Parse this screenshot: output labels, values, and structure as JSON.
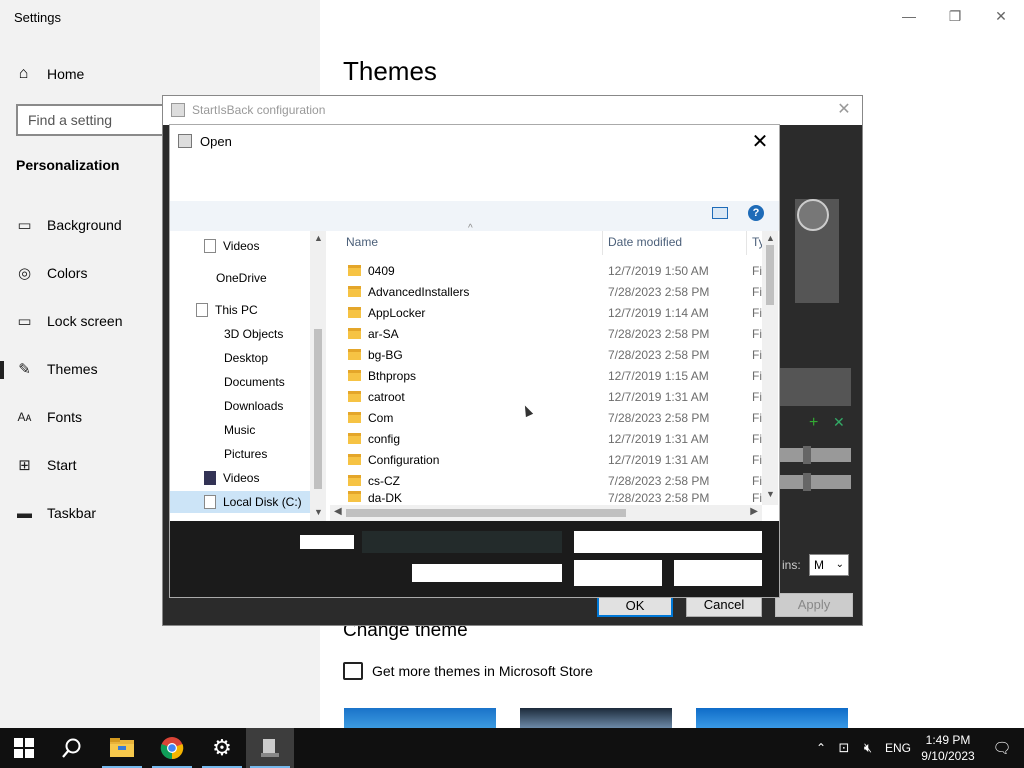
{
  "settings": {
    "title": "Settings",
    "home_label": "Home",
    "search_placeholder": "Find a setting",
    "section": "Personalization",
    "nav": [
      {
        "label": "Background",
        "icon": "image-icon"
      },
      {
        "label": "Colors",
        "icon": "palette-icon"
      },
      {
        "label": "Lock screen",
        "icon": "lock-screen-icon"
      },
      {
        "label": "Themes",
        "icon": "brush-icon"
      },
      {
        "label": "Fonts",
        "icon": "font-icon"
      },
      {
        "label": "Start",
        "icon": "start-grid-icon"
      },
      {
        "label": "Taskbar",
        "icon": "taskbar-icon"
      }
    ],
    "active_nav": "Themes",
    "heading": "Themes",
    "change_theme": "Change theme",
    "store_link": "Get more themes in Microsoft Store"
  },
  "startisback": {
    "title": "StartIsBack configuration",
    "margins_label": "ins:",
    "margins_value": "M",
    "ok": "OK",
    "cancel": "Cancel",
    "apply": "Apply"
  },
  "open_dialog": {
    "title": "Open",
    "nav_tree": [
      {
        "label": "Videos",
        "indent": 1
      },
      {
        "label": "OneDrive",
        "indent": 0
      },
      {
        "label": "This PC",
        "indent": 0
      },
      {
        "label": "3D Objects",
        "indent": 2
      },
      {
        "label": "Desktop",
        "indent": 2
      },
      {
        "label": "Documents",
        "indent": 2
      },
      {
        "label": "Downloads",
        "indent": 2
      },
      {
        "label": "Music",
        "indent": 2
      },
      {
        "label": "Pictures",
        "indent": 2
      },
      {
        "label": "Videos",
        "indent": 2
      },
      {
        "label": "Local Disk (C:)",
        "indent": 2,
        "selected": true
      }
    ],
    "columns": {
      "name": "Name",
      "date": "Date modified",
      "type": "Ty"
    },
    "files": [
      {
        "name": "0409",
        "date": "12/7/2019 1:50 AM",
        "type": "Fi"
      },
      {
        "name": "AdvancedInstallers",
        "date": "7/28/2023 2:58 PM",
        "type": "Fi"
      },
      {
        "name": "AppLocker",
        "date": "12/7/2019 1:14 AM",
        "type": "Fi"
      },
      {
        "name": "ar-SA",
        "date": "7/28/2023 2:58 PM",
        "type": "Fi"
      },
      {
        "name": "bg-BG",
        "date": "7/28/2023 2:58 PM",
        "type": "Fi"
      },
      {
        "name": "Bthprops",
        "date": "12/7/2019 1:15 AM",
        "type": "Fi"
      },
      {
        "name": "catroot",
        "date": "12/7/2019 1:31 AM",
        "type": "Fi"
      },
      {
        "name": "Com",
        "date": "7/28/2023 2:58 PM",
        "type": "Fi"
      },
      {
        "name": "config",
        "date": "12/7/2019 1:31 AM",
        "type": "Fi"
      },
      {
        "name": "Configuration",
        "date": "12/7/2019 1:31 AM",
        "type": "Fi"
      },
      {
        "name": "cs-CZ",
        "date": "7/28/2023 2:58 PM",
        "type": "Fi"
      },
      {
        "name": "da-DK",
        "date": "7/28/2023 2:58 PM",
        "type": "Fi"
      }
    ]
  },
  "taskbar": {
    "language": "ENG",
    "time": "1:49 PM",
    "date": "9/10/2023"
  }
}
